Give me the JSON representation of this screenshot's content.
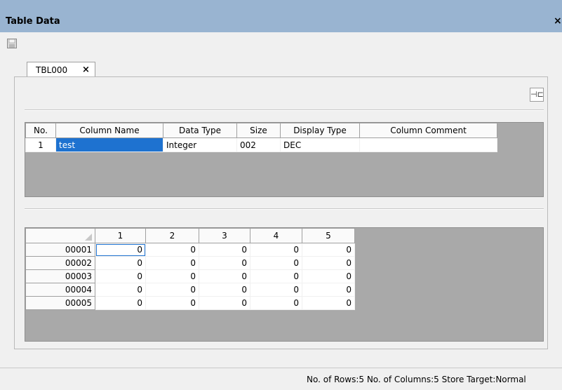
{
  "window": {
    "title": "Table Data",
    "close_glyph": "×"
  },
  "toolbar": {
    "save_icon": "save-icon"
  },
  "tab": {
    "label": "TBL000",
    "close_glyph": "×"
  },
  "pin_button": {
    "icon": "pin-icon",
    "glyph": "⊣⊏"
  },
  "column_definitions": {
    "headers": [
      "No.",
      "Column Name",
      "Data Type",
      "Size",
      "Display Type",
      "Column Comment"
    ],
    "rows": [
      {
        "no": "1",
        "name": "test",
        "data_type": "Integer",
        "size": "002",
        "display_type": "DEC",
        "comment": ""
      }
    ]
  },
  "data_grid": {
    "column_headers": [
      "1",
      "2",
      "3",
      "4",
      "5"
    ],
    "rows": [
      {
        "id": "00001",
        "values": [
          "0",
          "0",
          "0",
          "0",
          "0"
        ]
      },
      {
        "id": "00002",
        "values": [
          "0",
          "0",
          "0",
          "0",
          "0"
        ]
      },
      {
        "id": "00003",
        "values": [
          "0",
          "0",
          "0",
          "0",
          "0"
        ]
      },
      {
        "id": "00004",
        "values": [
          "0",
          "0",
          "0",
          "0",
          "0"
        ]
      },
      {
        "id": "00005",
        "values": [
          "0",
          "0",
          "0",
          "0",
          "0"
        ]
      }
    ]
  },
  "status": {
    "text": "No. of Rows:5  No. of Columns:5  Store Target:Normal"
  }
}
